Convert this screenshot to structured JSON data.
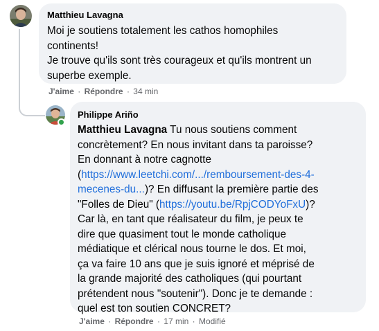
{
  "comment1": {
    "author": "Matthieu Lavagna",
    "text": "Moi je soutiens totalement les cathos homophiles\ncontinents!\nJe trouve qu'ils sont très courageux et qu'ils montrent un\nsuperbe exemple.",
    "like_label": "J'aime",
    "reply_label": "Répondre",
    "time": "34 min",
    "avatar_icon": "profile-photo"
  },
  "reply": {
    "author": "Philippe Ariño",
    "mention": "Matthieu Lavagna",
    "text_1": " Tu nous soutiens comment\nconcrètement? En nous invitant dans ta paroisse?\nEn donnant à notre cagnotte\n(",
    "link_1": "https://www.leetchi.com/.../remboursement-des-4-\nmecenes-du...",
    "text_2": ")? En diffusant la première partie des\n\"Folles de Dieu\" (",
    "link_2": "https://youtu.be/RpjCODYoFxU",
    "text_3": ")?\nCar là, en tant que réalisateur du film, je peux te\ndire que quasiment tout le monde catholique\nmédiatique et clérical nous tourne le dos. Et moi,\nça va faire 10 ans que je suis ignoré et méprisé de\nla grande majorité des catholiques (qui pourtant\nprétendent nous \"soutenir\"). Donc je te demande :\nquel est ton soutien CONCRET?",
    "like_label": "J'aime",
    "reply_label": "Répondre",
    "time": "17 min",
    "edited_label": "Modifié",
    "avatar_icon": "profile-photo",
    "online_color": "#31a24c"
  },
  "colors": {
    "bubble": "#f0f2f5",
    "link": "#216fdb",
    "meta": "#65676b",
    "thread_line": "#ccd0d5"
  }
}
